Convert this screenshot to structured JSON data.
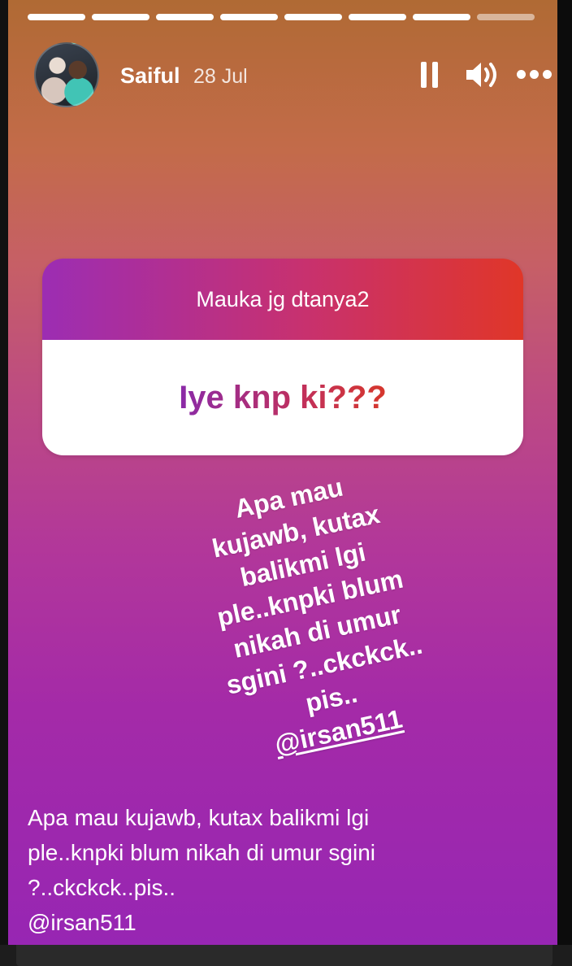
{
  "progress": {
    "total": 8,
    "completed": 7
  },
  "header": {
    "username": "Saiful",
    "date": "28 Jul",
    "controls": {
      "pause_icon": "pause-icon",
      "sound_icon": "speaker-icon",
      "more_icon": "more-icon"
    }
  },
  "question_sticker": {
    "prompt": "Mauka jg dtanya2",
    "answer": "Iye knp ki???"
  },
  "overlay_text": {
    "lines": [
      "Apa mau",
      "kujawb, kutax",
      "balikmi lgi",
      "ple..knpki blum",
      "nikah di umur",
      "sgini ?..ckckck..",
      "pis..",
      "@irsan511"
    ]
  },
  "caption": {
    "lines": [
      "Apa mau kujawb, kutax balikmi lgi",
      "ple..knpki blum nikah di umur sgini",
      "?..ckckck..pis..",
      "@irsan511"
    ]
  },
  "colors": {
    "sticker_gradient_start": "#9c2db3",
    "sticker_gradient_end": "#e03628",
    "background_top": "#b06a34",
    "background_bottom": "#9726b3"
  }
}
